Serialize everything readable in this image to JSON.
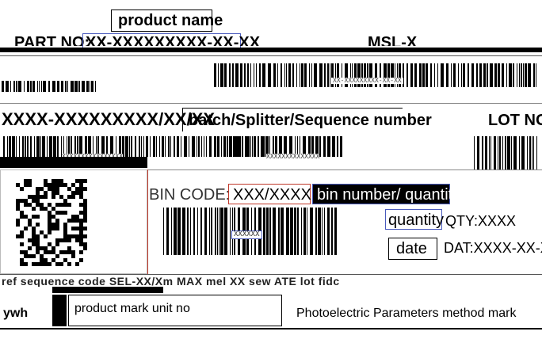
{
  "label": {
    "product_name": "product name",
    "part_no_prefix": "PART NO:",
    "part_no_value": "XX-XXXXXXXXX-XX-XX",
    "msl": "MSL-X",
    "part_barcode_text": "XX-XXXXXXXXX-XX-XX",
    "part_no_full": "XXXX-XXXXXXXXX/XX/XX",
    "batch_label": "batch/Splitter/Sequence number",
    "lot_no": "LOT NO",
    "small_barcode_text_1": "XXXXXXXXXXXXXXXX",
    "small_barcode_text_2": "XXXXXXXXXXXXXX",
    "bin_code_label": "BIN CODE:",
    "bin_code_value": "XXX/XXXX",
    "bin_quantity": "bin number/ quantity",
    "quantity_label": "quantity",
    "qty_value": "QTY:XXXX",
    "xxx_code": "XXXXXX",
    "date_label": "date",
    "date_value": "DAT:XXXX-XX-XX",
    "garbled_line": "ref sequence code SEL-XX/Xm  MAX mel XX  sew  ATE  lot fidc",
    "bottom_left": "ywh",
    "bottom_mid": "product mark unit no",
    "bottom_right": "Photoelectric Parameters method mark"
  }
}
